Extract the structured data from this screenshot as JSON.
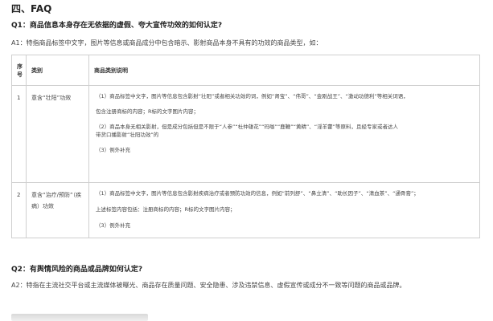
{
  "section": {
    "title": "四、FAQ"
  },
  "q1": {
    "question": "Q1：商品信息本身存在无依据的虚假、夸大宣传功效的如何认定?",
    "answer": "A1：特指商品标签中文字，图片等信息或商品成分中包含暗示、影射商品本身不具有的功效的商品类型，如："
  },
  "table": {
    "headers": {
      "no": "序号",
      "category": "类别",
      "description": "商品类别说明"
    },
    "rows": [
      {
        "no": "1",
        "category": "意含“壮阳”功效",
        "desc": [
          "（1）商品标签中文字，图片等信息包含影射“壮阳”或者相关功效的词，例如“肾宝”、“伟哥”、“金刚战王”、“激动功德利”等相关词语，",
          "包含注册商标的内容；R标的文字图片内容；",
          "（2）商品本身无相关影射，但是成分包括但是不限于“人参”“杜仲雄花”“玛咖”“鹿鞭”“黄精”、“淫羊藿”等原料，且经专家或者达人",
          "带货口播影射“壮阳功效”的",
          "（3）例外补充"
        ]
      },
      {
        "no": "2",
        "category": "意含“治疗/预防”（疾病）功效",
        "desc": [
          "（1）商品标签中文字，图片等信息包含影射疾病治疗或者预防功效的信息，例如“前列舒”、“鼻立清”、“助长因子”、“清血茶”、“通骨膏”；",
          "上述标签内容包括：注册商标的内容；R标的文字图片内容；",
          "（3）例外补充"
        ]
      }
    ]
  },
  "q2": {
    "question": "Q2：有舆情风险的商品或品牌如何认定?",
    "answer": "A2：特指在主流社交平台或主流媒体被曝光、商品存在质量问题、安全隐患、涉及违禁信息、虚假宣传或成分不一致等问题的商品或品牌。"
  }
}
